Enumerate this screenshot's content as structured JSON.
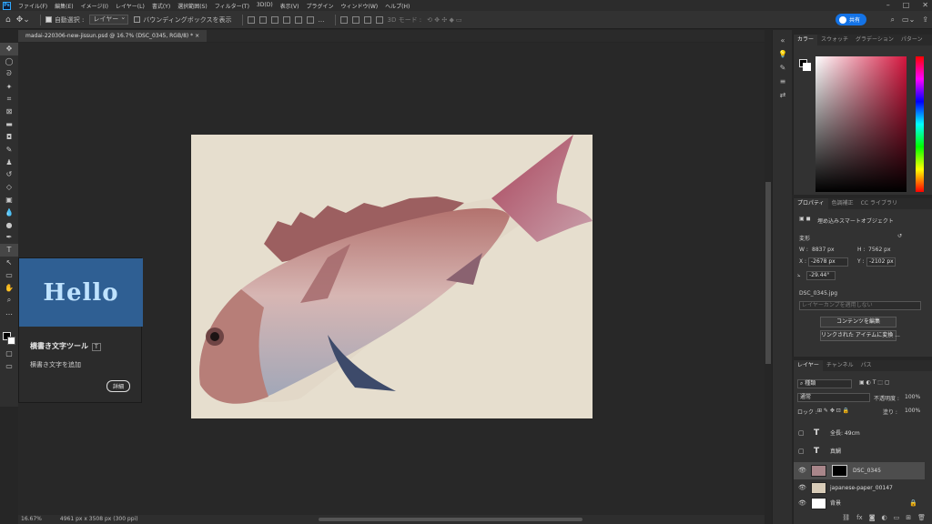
{
  "app": {
    "logo": "Ps"
  },
  "menu": [
    "ファイル(F)",
    "編集(E)",
    "イメージ(I)",
    "レイヤー(L)",
    "書式(Y)",
    "選択範囲(S)",
    "フィルター(T)",
    "3D(D)",
    "表示(V)",
    "プラグイン",
    "ウィンドウ(W)",
    "ヘルプ(H)"
  ],
  "options": {
    "auto_select": "自動選択 :",
    "target": "レイヤー",
    "bbox": "バウンディングボックスを表示",
    "mode3d": "3D モード :",
    "share": "共有"
  },
  "document": {
    "tab": "madai-220306-new-jissun.psd @ 16.7% (DSC_0345, RGB/8) *",
    "zoom": "16.67%",
    "size": "4961 px x 3508 px (300 ppi)"
  },
  "tooltip": {
    "hello": "Hello",
    "title": "横書き文字ツール",
    "key": "T",
    "desc": "横書き文字を追加",
    "more": "詳細"
  },
  "color_panel": {
    "tabs": [
      "カラー",
      "スウォッチ",
      "グラデーション",
      "パターン"
    ],
    "fg": "#000000",
    "bg": "#ffffff",
    "hue_color": "#d4163e"
  },
  "properties": {
    "tabs": [
      "プロパティ",
      "色調補正",
      "CC ライブラリ"
    ],
    "type": "埋め込みスマートオブジェクト",
    "section": "変形",
    "w_label": "W :",
    "w": "8837 px",
    "h_label": "H :",
    "h": "7562 px",
    "x_label": "X :",
    "x": "-2678 px",
    "y_label": "Y :",
    "y": "-2102 px",
    "angle": "-29.44°",
    "file": "DSC_0345.jpg",
    "comp_placeholder": "レイヤーカンプを適用しない",
    "edit_btn": "コンテンツを編集",
    "convert_btn": "リンクされた アイテムに変換 ..."
  },
  "layers": {
    "tabs": [
      "レイヤー",
      "チャンネル",
      "パス"
    ],
    "filter": "種類",
    "blend": "通常",
    "opacity_label": "不透明度 :",
    "opacity": "100%",
    "lock_label": "ロック :",
    "fill_label": "塗り :",
    "fill": "100%",
    "items": [
      {
        "name": "全長: 49cm",
        "kind": "text"
      },
      {
        "name": "真鯛",
        "kind": "text"
      },
      {
        "name": "DSC_0345",
        "kind": "smart"
      },
      {
        "name": "japanese-paper_00147",
        "kind": "image"
      },
      {
        "name": "背景",
        "kind": "bg"
      }
    ]
  }
}
